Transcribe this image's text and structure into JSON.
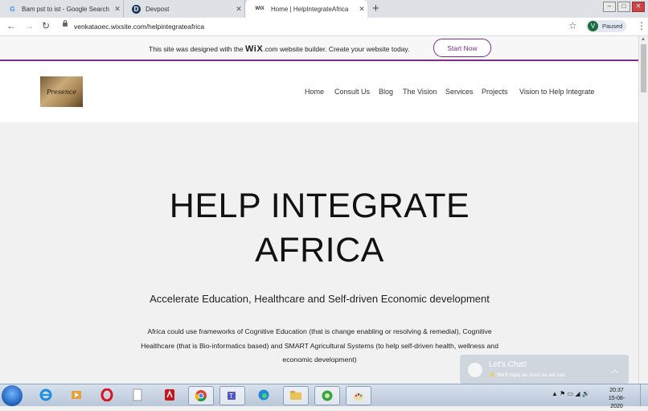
{
  "browser": {
    "tabs": [
      {
        "title": "Bam pst to ist - Google Search",
        "favicon": "G",
        "active": false
      },
      {
        "title": "Devpost",
        "favicon": "D",
        "active": false
      },
      {
        "title": "Home | HelpIntegrateAfrica",
        "favicon": "WIX",
        "active": true
      }
    ],
    "url": "venkataoec.wixsite.com/helpintegrateafrica",
    "profile_initial": "V",
    "profile_status": "Paused"
  },
  "wix_banner": {
    "text_before": "This site was designed with the ",
    "brand": "WiX",
    "text_after": ".com website builder. Create your website today.",
    "button": "Start Now",
    "accent": "#7a2e8a"
  },
  "site": {
    "logo_text": "Presence",
    "menu": [
      "Home",
      "Consult Us",
      "Blog",
      "The Vision",
      "Services",
      "Projects",
      "Vision to Help Integrate"
    ]
  },
  "hero": {
    "title_line1": "HELP INTEGRATE",
    "title_line2": "AFRICA",
    "subtitle": "Accelerate Education, Healthcare and Self-driven Economic development",
    "body_line1": "Africa could use frameworks of Cognitive Education (that is change enabling or resolving & remedial), Cognitive",
    "body_line2": "Healthcare (that is Bio-informatics based) and SMART Agricultural Systems (to help self-driven health, wellness and",
    "body_line3": "economic development)"
  },
  "chat": {
    "title": "Let's Chat!",
    "subtitle": "We'll reply as soon as we can"
  },
  "taskbar": {
    "time": "20:37",
    "date": "15-08-2020"
  }
}
